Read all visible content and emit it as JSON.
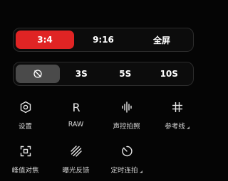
{
  "aspect_ratio": {
    "options": [
      "3:4",
      "9:16",
      "全屏"
    ],
    "selected": "3:4",
    "accent": "#e02424"
  },
  "timer": {
    "options": [
      "off-icon",
      "3S",
      "5S",
      "10S"
    ],
    "selected": "off"
  },
  "settings": [
    {
      "label": "设置",
      "icon": "gear-icon"
    },
    {
      "label": "RAW",
      "icon": "raw-icon"
    },
    {
      "label": "声控拍照",
      "icon": "voice-wave-icon"
    },
    {
      "label": "参考线",
      "icon": "grid-lines-icon"
    },
    {
      "label": "峰值对焦",
      "icon": "focus-peaking-icon"
    },
    {
      "label": "曝光反馈",
      "icon": "exposure-feedback-icon"
    },
    {
      "label": "定时连拍",
      "icon": "timer-burst-icon"
    }
  ]
}
